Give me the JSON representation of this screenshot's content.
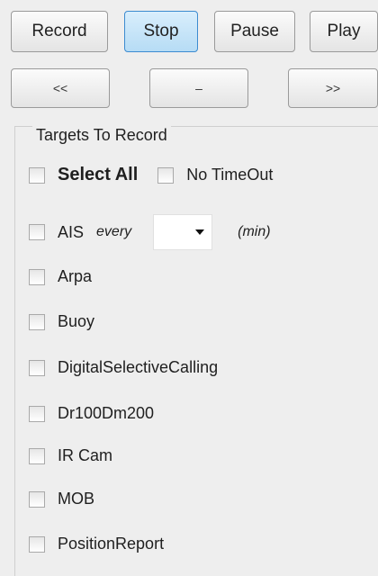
{
  "toolbar": {
    "record_label": "Record",
    "stop_label": "Stop",
    "pause_label": "Pause",
    "play_label": "Play"
  },
  "nav": {
    "prev_label": "<<",
    "mid_label": "–",
    "next_label": ">>"
  },
  "targets": {
    "title": "Targets To Record",
    "select_all": "Select All",
    "no_timeout": "No TimeOut",
    "ais_label": "AIS",
    "ais_every": "every",
    "ais_unit": "(min)",
    "ais_interval_value": "",
    "items": [
      "Arpa",
      "Buoy",
      "DigitalSelectiveCalling",
      "Dr100Dm200",
      "IR Cam",
      "MOB",
      "PositionReport"
    ]
  },
  "colors": {
    "background": "#eeeeee",
    "active_button_border": "#3c8bd0",
    "active_button_fill": "#c7e5f8"
  }
}
